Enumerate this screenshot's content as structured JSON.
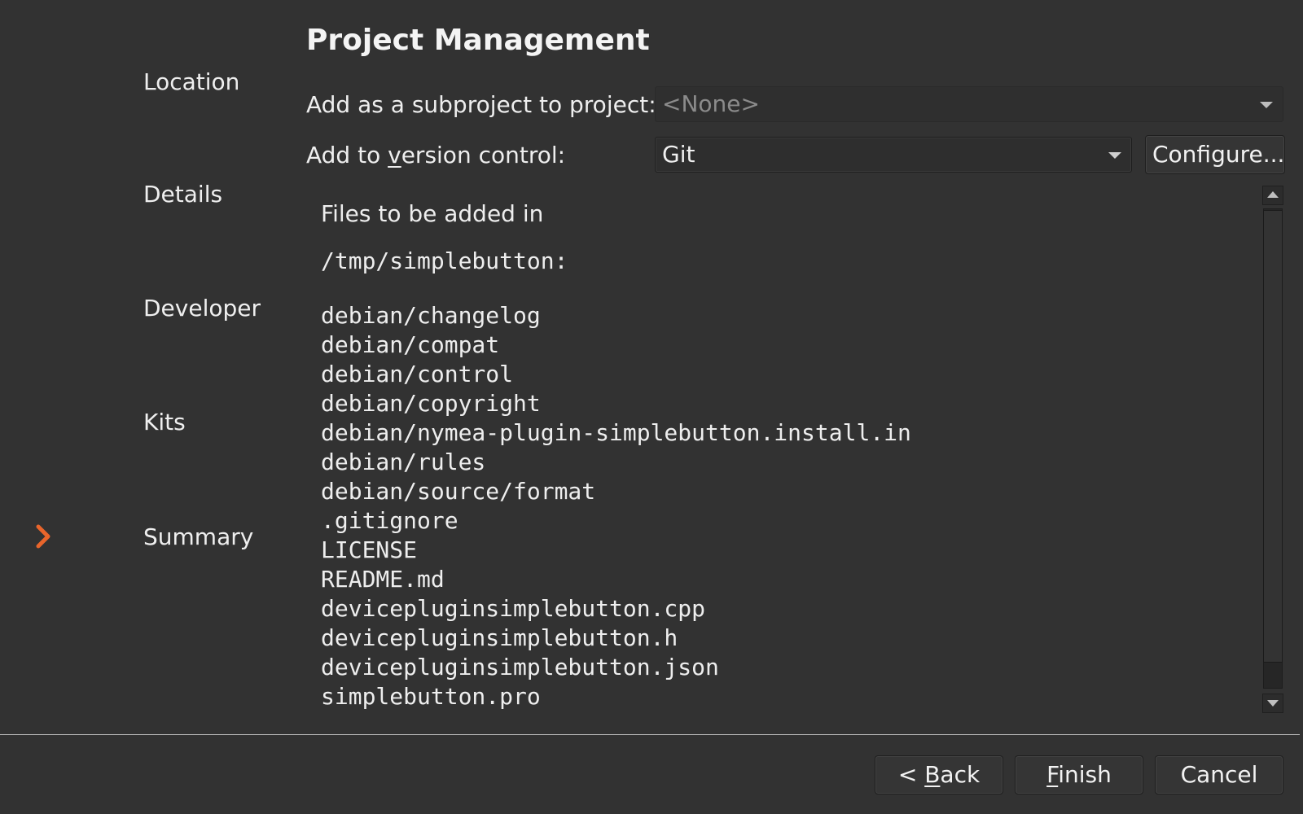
{
  "steps": [
    {
      "label": "Location"
    },
    {
      "label": "Details"
    },
    {
      "label": "Developer"
    },
    {
      "label": "Kits"
    },
    {
      "label": "Summary",
      "current": true
    }
  ],
  "colors": {
    "background": "#323232",
    "current_step_arrow": "#e9652b"
  },
  "page": {
    "title": "Project Management"
  },
  "subproject": {
    "label": "Add as a subproject to project:",
    "value": "<None>"
  },
  "version_control": {
    "label_pre": "Add to ",
    "label_mnemonic": "v",
    "label_post": "ersion control:",
    "value": "Git",
    "configure_label": "Configure..."
  },
  "summary": {
    "heading": "Files to be added in",
    "path": "/tmp/simplebutton:",
    "files": [
      "debian/changelog",
      "debian/compat",
      "debian/control",
      "debian/copyright",
      "debian/nymea-plugin-simplebutton.install.in",
      "debian/rules",
      "debian/source/format",
      ".gitignore",
      "LICENSE",
      "README.md",
      "devicepluginsimplebutton.cpp",
      "devicepluginsimplebutton.h",
      "devicepluginsimplebutton.json",
      "simplebutton.pro"
    ]
  },
  "buttons": {
    "back_pre": "< ",
    "back_mnemonic": "B",
    "back_post": "ack",
    "finish_mnemonic": "F",
    "finish_post": "inish",
    "cancel": "Cancel"
  }
}
